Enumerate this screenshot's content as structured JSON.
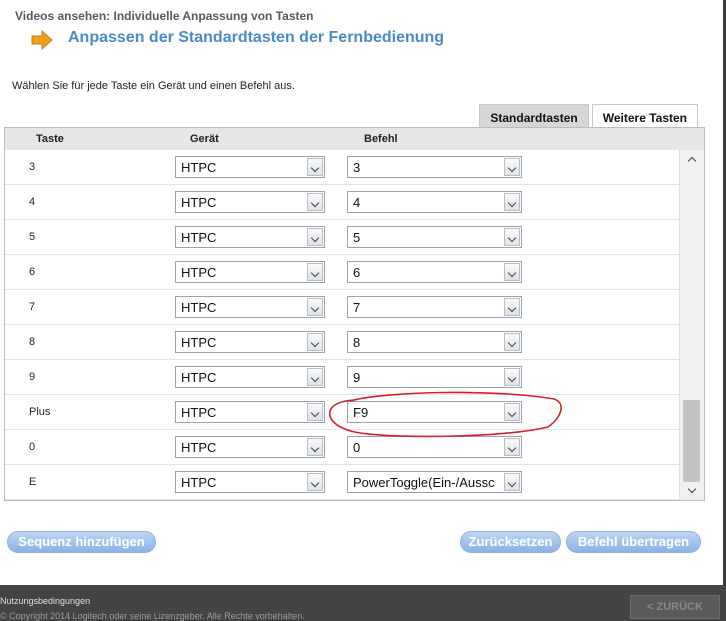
{
  "header": {
    "breadcrumb": "Videos ansehen: Individuelle Anpassung von Tasten",
    "title": "Anpassen der Standardtasten der Fernbedienung",
    "instruction": "Wählen Sie für jede Taste ein Gerät und einen Befehl aus."
  },
  "tabs": [
    {
      "label": "Standardtasten",
      "active": true
    },
    {
      "label": "Weitere Tasten",
      "active": false
    }
  ],
  "table": {
    "columns": {
      "key": "Taste",
      "device": "Gerät",
      "command": "Befehl"
    },
    "rows": [
      {
        "key": "3",
        "device": "HTPC",
        "command": "3"
      },
      {
        "key": "4",
        "device": "HTPC",
        "command": "4"
      },
      {
        "key": "5",
        "device": "HTPC",
        "command": "5"
      },
      {
        "key": "6",
        "device": "HTPC",
        "command": "6"
      },
      {
        "key": "7",
        "device": "HTPC",
        "command": "7"
      },
      {
        "key": "8",
        "device": "HTPC",
        "command": "8"
      },
      {
        "key": "9",
        "device": "HTPC",
        "command": "9"
      },
      {
        "key": "Plus",
        "device": "HTPC",
        "command": "F9"
      },
      {
        "key": "0",
        "device": "HTPC",
        "command": "0"
      },
      {
        "key": "E",
        "device": "HTPC",
        "command": "PowerToggle(Ein-/Aussc"
      }
    ]
  },
  "buttons": {
    "add_sequence": "Sequenz hinzufügen",
    "reset": "Zurücksetzen",
    "apply": "Befehl übertragen"
  },
  "footer": {
    "terms": "Nutzungsbedingungen",
    "copyright": "© Copyright 2014 Logitech oder seine Lizenzgeber. Alle Rechte vorbehalten.",
    "back": "< ZURÜCK"
  },
  "colors": {
    "title": "#4a8ac8",
    "button": "#8ab3e6",
    "annotation": "#d4202a",
    "arrow": "#f0a020"
  },
  "icons": [
    "arrow-right-icon",
    "chevron-down-icon",
    "chevron-up-icon"
  ]
}
